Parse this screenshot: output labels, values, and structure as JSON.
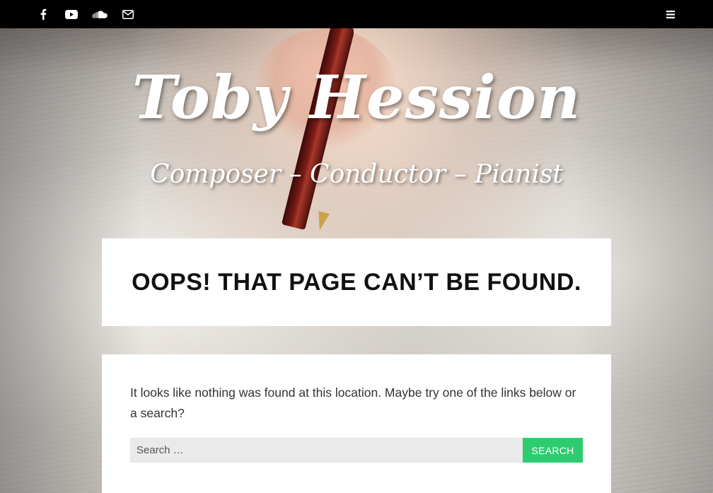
{
  "header": {
    "social": [
      {
        "name": "facebook-icon",
        "label": "f"
      },
      {
        "name": "youtube-icon",
        "label": "▶"
      },
      {
        "name": "soundcloud-icon",
        "label": "☁"
      },
      {
        "name": "email-icon",
        "label": "✉"
      }
    ],
    "menu_icon": "menu-icon"
  },
  "site": {
    "title": "Toby Hession",
    "description": "Composer – Conductor – Pianist"
  },
  "error": {
    "title": "Oops! That page can’t be found.",
    "message": "It looks like nothing was found at this location. Maybe try one of the links below or a search?"
  },
  "search": {
    "placeholder": "Search …",
    "button_label": "Search"
  },
  "colors": {
    "topbar": "#000000",
    "accent": "#2ecc71"
  }
}
